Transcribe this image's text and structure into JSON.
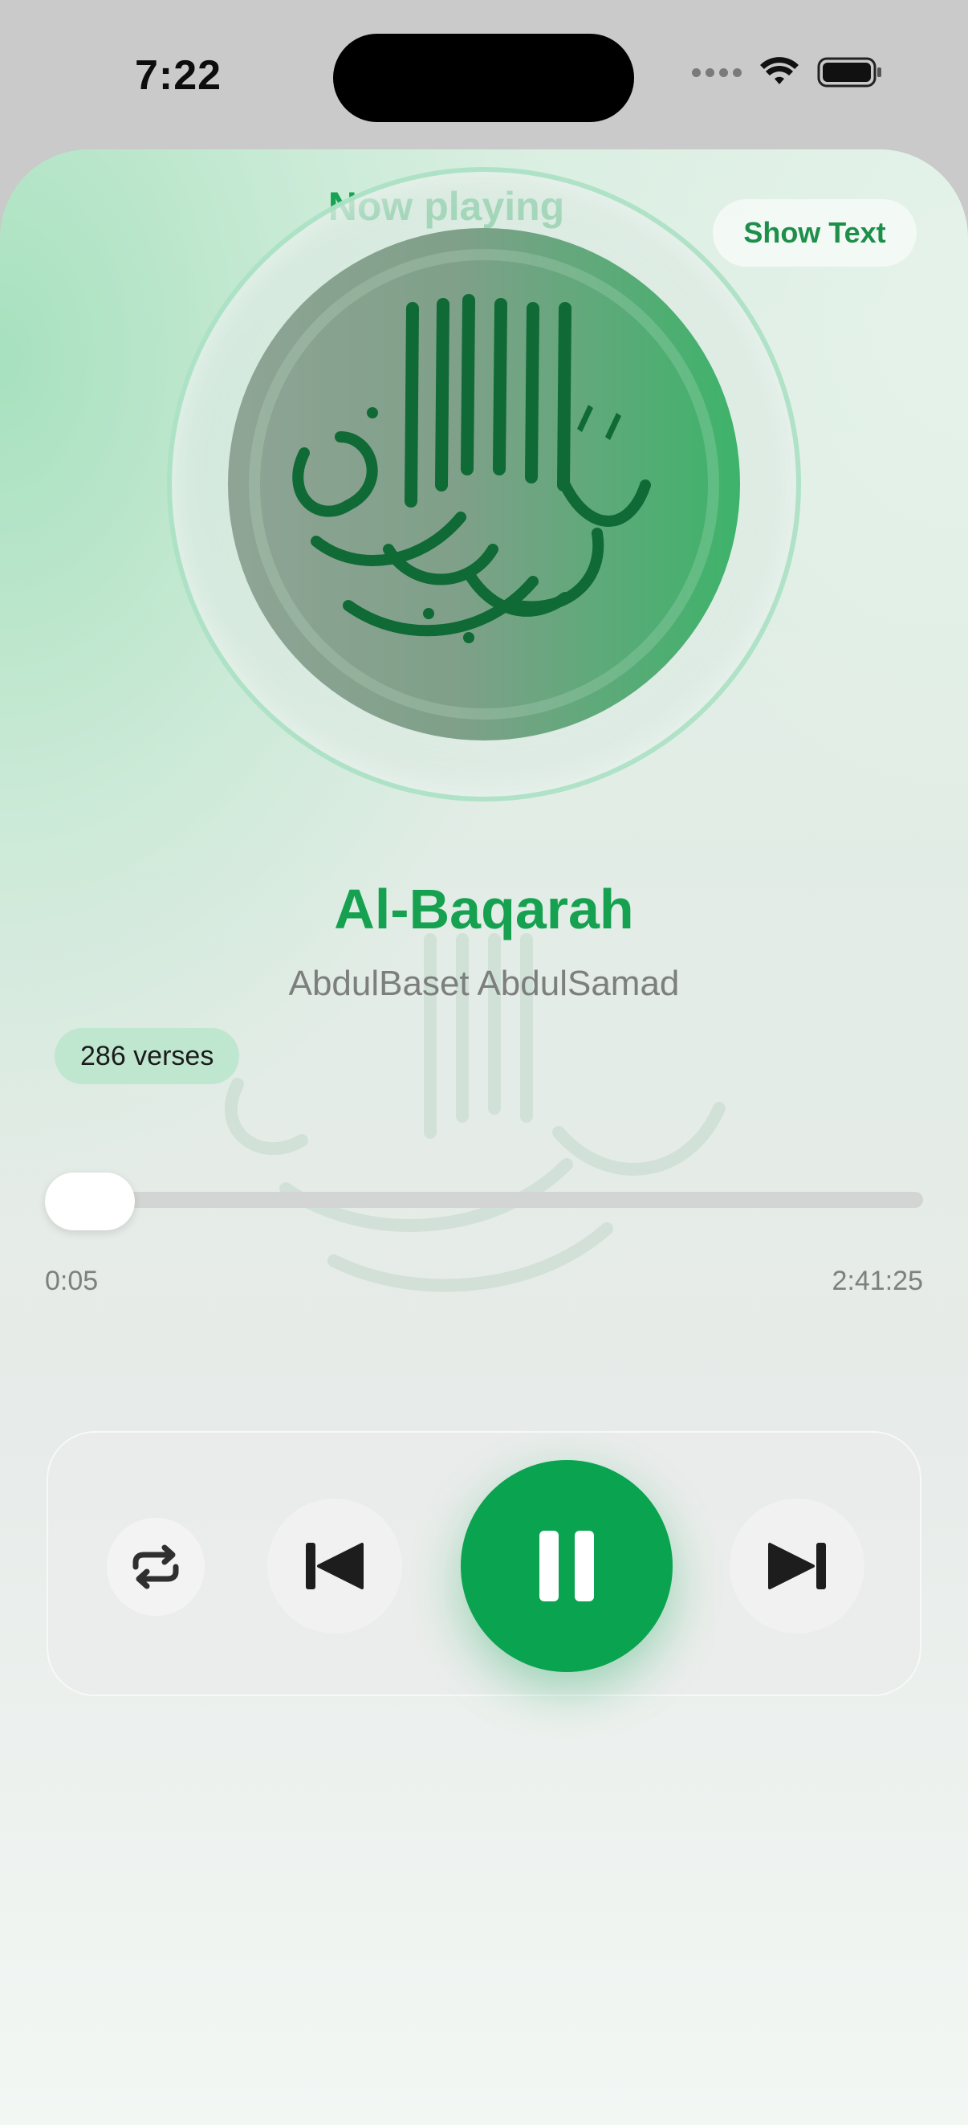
{
  "status_bar": {
    "time": "7:22"
  },
  "header": {
    "title": "Now playing",
    "subtitle": "Al-Baqarah",
    "show_text_label": "Show Text"
  },
  "track": {
    "title": "Al-Baqarah",
    "reciter": "AbdulBaset AbdulSamad",
    "verses_badge": "286 verses"
  },
  "progress": {
    "current": "0:05",
    "duration": "2:41:25",
    "fraction": 0.0005
  },
  "controls": {
    "repeat_icon": "repeat-icon",
    "prev_icon": "skip-back-icon",
    "play_state_icon": "pause-icon",
    "next_icon": "skip-forward-icon"
  },
  "colors": {
    "accent": "#0aa34f",
    "badge": "#bfe6cf"
  }
}
